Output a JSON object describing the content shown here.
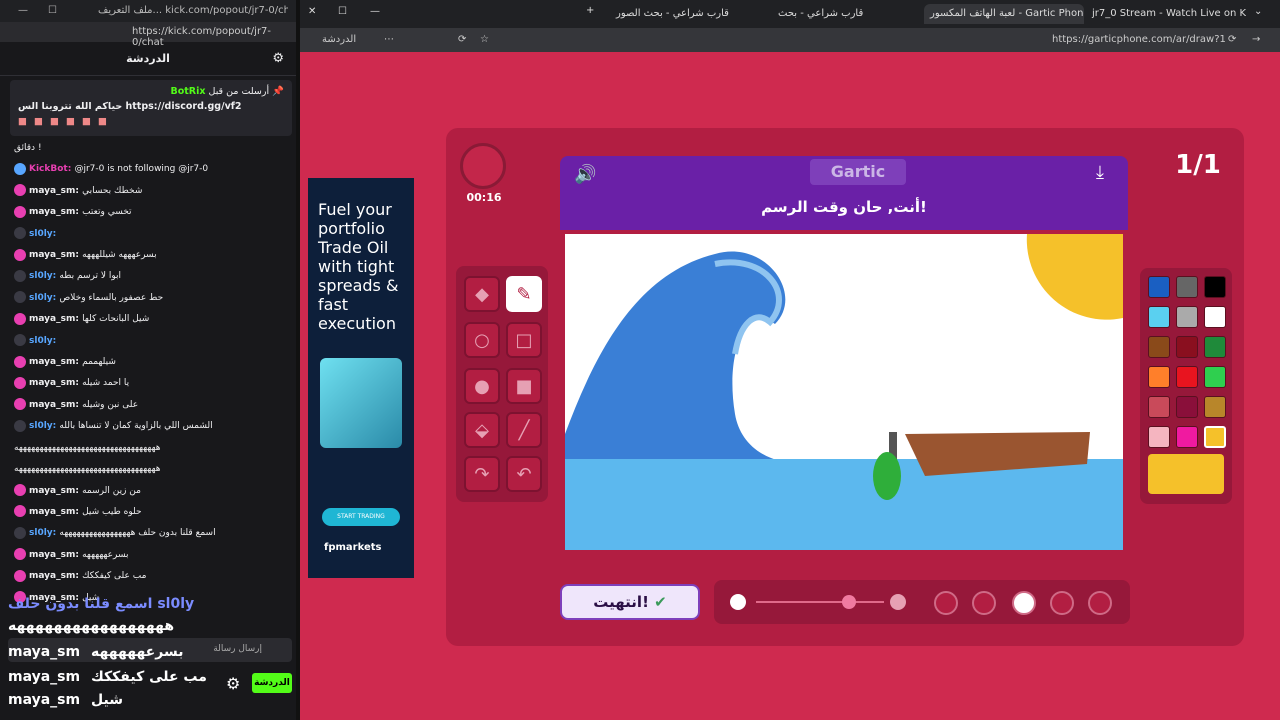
{
  "left_window": {
    "tab_title": "ملف التعريف... kick.com/popout/jr7-0/chat -",
    "url": "https://kick.com/popout/jr7-0/chat",
    "chat_title": "الدردشة",
    "pinned": {
      "label": "أرسلت من قبل",
      "author": "BotRix",
      "text": "حياكم الله تتروبنا الس https://discord.gg/vf2"
    },
    "messages": [
      {
        "user": "",
        "text": "دقائق !"
      },
      {
        "user": "KickBot",
        "text": "@jr7-0 is not following @jr7-0"
      },
      {
        "user": "maya_sm",
        "text": "شخطك بحسابي"
      },
      {
        "user": "maya_sm",
        "text": "تخسي وتعتب"
      },
      {
        "user": "sl0ly",
        "text": ""
      },
      {
        "user": "maya_sm",
        "text": "بسرعهههه شيللهههه"
      },
      {
        "user": "sl0ly",
        "text": "ابوا لا ترسم بطه"
      },
      {
        "user": "sl0ly",
        "text": "حط عصفور بالسماء وخلاص"
      },
      {
        "user": "maya_sm",
        "text": "شيل البانحات كلها"
      },
      {
        "user": "sl0ly",
        "text": ""
      },
      {
        "user": "maya_sm",
        "text": "شيلهممم"
      },
      {
        "user": "maya_sm",
        "text": "يا احمد شيله"
      },
      {
        "user": "maya_sm",
        "text": "على نبن وشيله"
      },
      {
        "user": "sl0ly",
        "text": "الشمس اللي بالزاوية كمان لا تنساها بالله"
      },
      {
        "user": "",
        "text": "ههههههههههههههههههههههههههههههههههه"
      },
      {
        "user": "",
        "text": "ههههههههههههههههههههههههههههههههههه"
      },
      {
        "user": "maya_sm",
        "text": "من زين الرسمه"
      },
      {
        "user": "maya_sm",
        "text": "حلوه طيب شيل"
      },
      {
        "user": "sl0ly",
        "text": "اسمع قلنا بدون حلف هههههههههههههههههه"
      },
      {
        "user": "maya_sm",
        "text": "بسرعهههههه"
      },
      {
        "user": "maya_sm",
        "text": "مب على كيفككك"
      },
      {
        "user": "maya_sm",
        "text": "شيل"
      }
    ],
    "overlay": {
      "line1_user": "sl0ly",
      "line1_text": "اسمع قلنا بدون حلف",
      "line2": "هههههههههههههههههه",
      "lines": [
        {
          "user": "maya_sm",
          "text": "بسرعهههههه"
        },
        {
          "user": "maya_sm",
          "text": "مب على كيفككك"
        },
        {
          "user": "maya_sm",
          "text": "شيل"
        }
      ]
    },
    "input_placeholder": "إرسال رسالة",
    "send_label": "الدردشة"
  },
  "right_window": {
    "tabs": [
      {
        "label": "jr7_0 Stream - Watch Live on Kick"
      },
      {
        "label": "لعبة الهاتف المكسور - Gartic Phone"
      },
      {
        "label": "قارب شراعي - بحث"
      },
      {
        "label": "قارب شراعي - بحث الصور"
      }
    ],
    "toolbar_label": "الدردشة",
    "url": "https://garticphone.com/ar/draw?1",
    "ad": {
      "headline": "Fuel your portfolio Trade Oil with tight spreads & fast execution",
      "cta": "START TRADING",
      "brand": "fpmarkets"
    },
    "game": {
      "timer": "00:16",
      "round": "1/1",
      "logo": "Gartic",
      "prompt": "أنت, حان وقت الرسم!",
      "done_label": "انتهيت!",
      "palette": [
        "#1a5fc2",
        "#666666",
        "#000000",
        "#5ad0f0",
        "#aaaaaa",
        "#ffffff",
        "#8a4a1a",
        "#8a0f1f",
        "#1f8a3a",
        "#ff7f2a",
        "#e8141f",
        "#2fcf4f",
        "#c94a5a",
        "#8a0f3a",
        "#b8862a",
        "#f5b5c0",
        "#f01aa0",
        "#f5c12a"
      ],
      "selected_color": "#f5c12a"
    }
  }
}
